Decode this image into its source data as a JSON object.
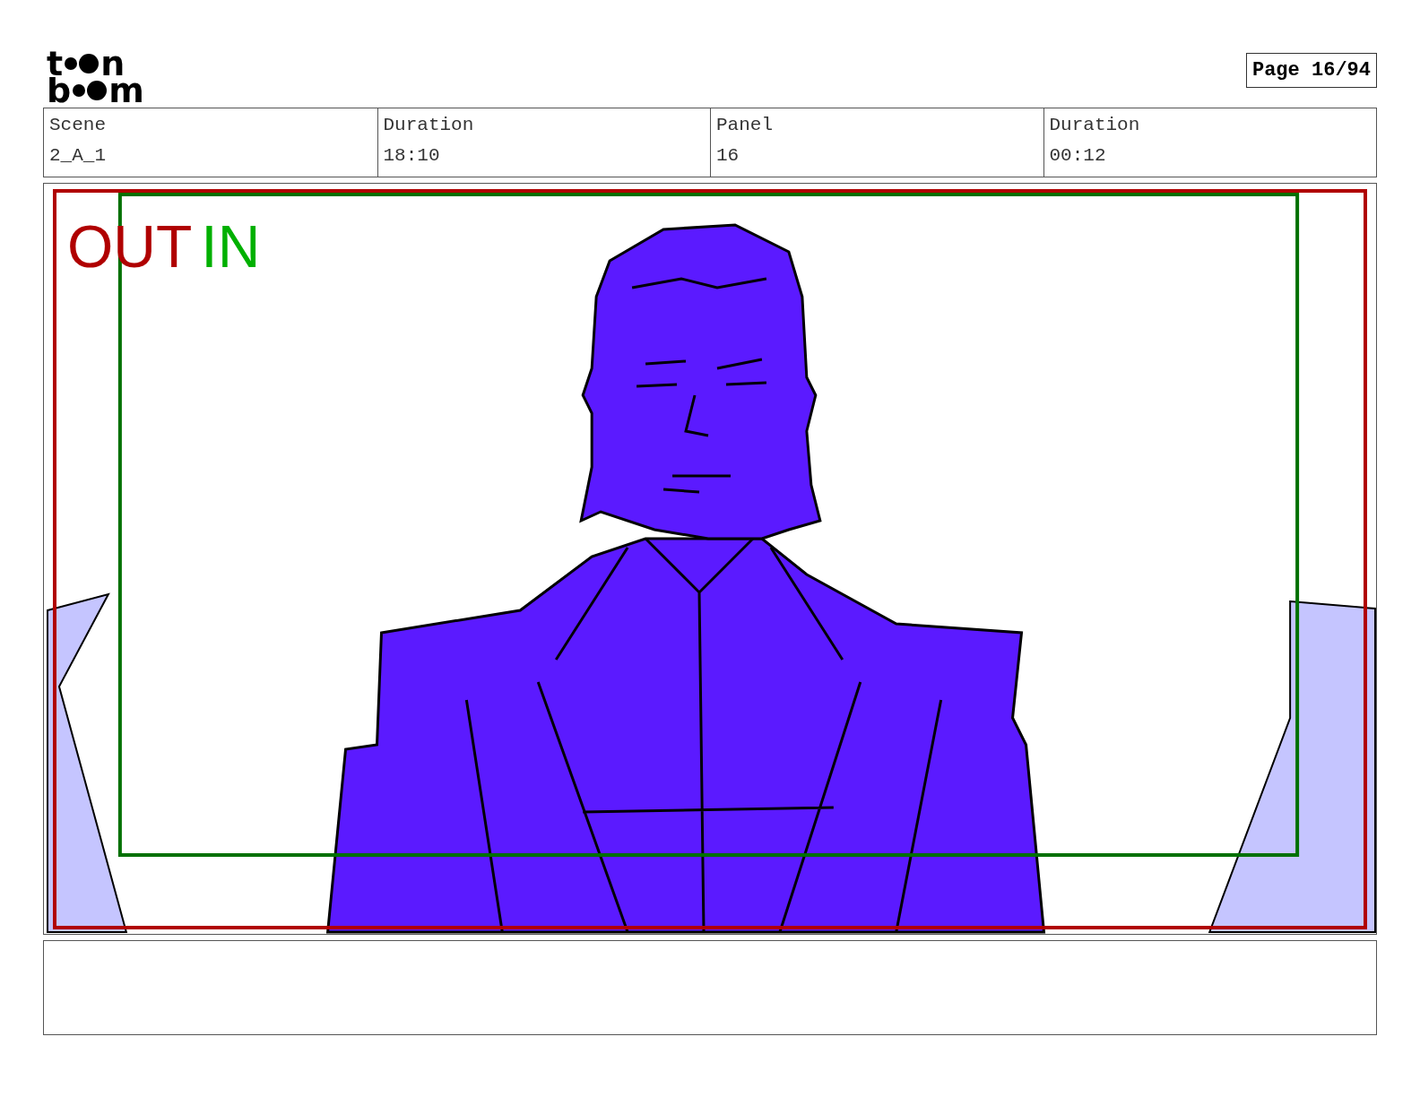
{
  "logo": {
    "rows": [
      {
        "first": "t",
        "last": "n"
      },
      {
        "first": "b",
        "last": "m"
      }
    ]
  },
  "page_label": "Page 16/94",
  "info": [
    {
      "label": "Scene",
      "value": "2_A_1"
    },
    {
      "label": "Duration",
      "value": "18:10"
    },
    {
      "label": "Panel",
      "value": "16"
    },
    {
      "label": "Duration",
      "value": "00:12"
    }
  ],
  "frame_labels": {
    "out": "OUT",
    "in": "IN"
  }
}
